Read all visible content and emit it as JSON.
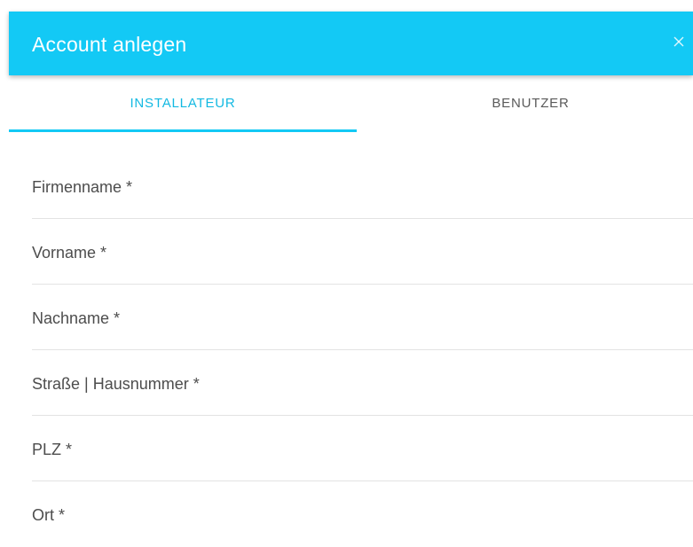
{
  "colors": {
    "accent": "#13c9f5",
    "tab_active_text": "#13b9e2",
    "tab_inactive_text": "#5a5a5a",
    "header_text": "#ffffff"
  },
  "header": {
    "title": "Account anlegen",
    "close_icon": "close-icon"
  },
  "tabs": [
    {
      "label": "INSTALLATEUR",
      "active": true
    },
    {
      "label": "BENUTZER",
      "active": false
    }
  ],
  "form": {
    "fields": [
      {
        "placeholder": "Firmenname *",
        "value": ""
      },
      {
        "placeholder": "Vorname *",
        "value": ""
      },
      {
        "placeholder": "Nachname *",
        "value": ""
      },
      {
        "placeholder": "Straße | Hausnummer *",
        "value": ""
      },
      {
        "placeholder": "PLZ *",
        "value": ""
      },
      {
        "placeholder": "Ort *",
        "value": ""
      }
    ]
  }
}
